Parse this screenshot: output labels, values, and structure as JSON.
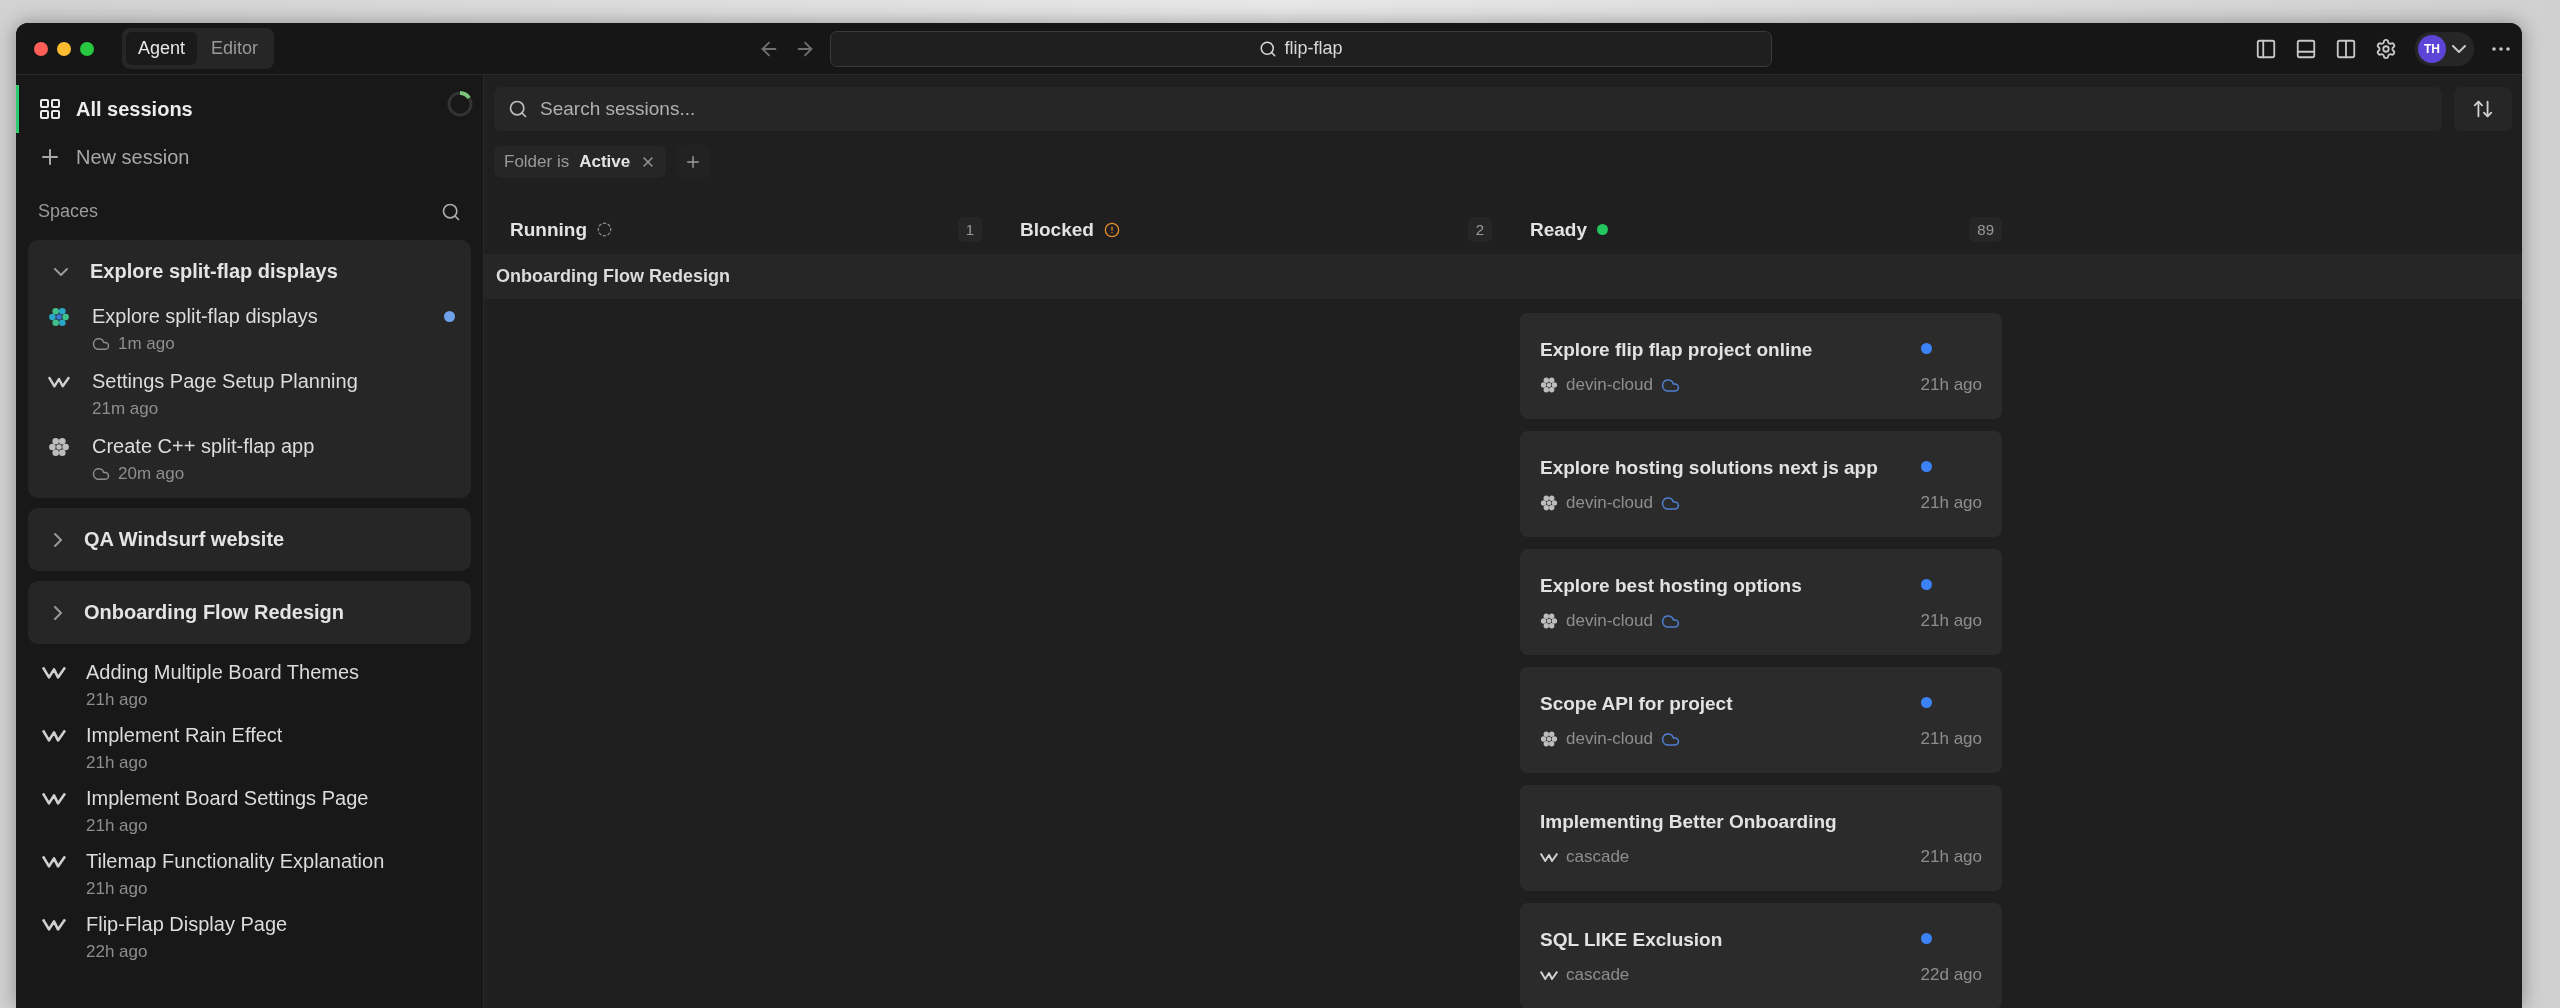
{
  "window": {
    "title": "flip-flap",
    "avatar": "TH",
    "mode_tabs": [
      {
        "label": "Agent",
        "selected": true
      },
      {
        "label": "Editor",
        "selected": false
      }
    ]
  },
  "sidebar": {
    "nav": [
      {
        "label": "All sessions",
        "kind": "grid",
        "selected": true
      },
      {
        "label": "New session",
        "kind": "plus",
        "selected": false
      }
    ],
    "spaces_label": "Spaces",
    "spaces": [
      {
        "title": "Explore split-flap displays",
        "expanded": true,
        "sessions": [
          {
            "title": "Explore split-flap displays",
            "time": "1m ago",
            "kind": "devin",
            "live": true,
            "cloud": true,
            "unread": true
          },
          {
            "title": "Settings Page Setup Planning",
            "time": "21m ago",
            "kind": "cascade",
            "cloud": false,
            "unread": false
          },
          {
            "title": "Create C++ split-flap app",
            "time": "20m ago",
            "kind": "devin",
            "live": false,
            "cloud": true,
            "unread": false
          }
        ]
      },
      {
        "title": "QA Windsurf website",
        "expanded": false
      },
      {
        "title": "Onboarding Flow Redesign",
        "expanded": false
      }
    ],
    "sessions": [
      {
        "title": "Adding Multiple Board Themes",
        "time": "21h ago",
        "kind": "cascade"
      },
      {
        "title": "Implement Rain Effect",
        "time": "21h ago",
        "kind": "cascade"
      },
      {
        "title": "Implement Board Settings Page",
        "time": "21h ago",
        "kind": "cascade"
      },
      {
        "title": "Tilemap Functionality Explanation",
        "time": "21h ago",
        "kind": "cascade"
      },
      {
        "title": "Flip-Flap Display Page",
        "time": "22h ago",
        "kind": "cascade"
      }
    ]
  },
  "search": {
    "placeholder": "Search sessions..."
  },
  "filter": {
    "field": "Folder is",
    "value": "Active"
  },
  "board": {
    "group_title": "Onboarding Flow Redesign",
    "columns": [
      {
        "title": "Running",
        "kind": "running",
        "count": "1"
      },
      {
        "title": "Blocked",
        "kind": "blocked",
        "count": "2"
      },
      {
        "title": "Ready",
        "kind": "ready",
        "count": "89",
        "cards": [
          {
            "title": "Explore flip flap project online",
            "source": "devin-cloud",
            "kind": "devin",
            "cloud": true,
            "time": "21h ago",
            "unread": true
          },
          {
            "title": "Explore hosting solutions next js app",
            "source": "devin-cloud",
            "kind": "devin",
            "cloud": true,
            "time": "21h ago",
            "unread": true
          },
          {
            "title": "Explore best hosting options",
            "source": "devin-cloud",
            "kind": "devin",
            "cloud": true,
            "time": "21h ago",
            "unread": true
          },
          {
            "title": "Scope API for project",
            "source": "devin-cloud",
            "kind": "devin",
            "cloud": true,
            "time": "21h ago",
            "unread": true
          },
          {
            "title": "Implementing Better Onboarding",
            "source": "cascade",
            "kind": "cascade",
            "cloud": false,
            "time": "21h ago",
            "unread": false
          },
          {
            "title": "SQL LIKE Exclusion",
            "source": "cascade",
            "kind": "cascade",
            "cloud": false,
            "time": "22d ago",
            "unread": true
          }
        ]
      }
    ]
  }
}
